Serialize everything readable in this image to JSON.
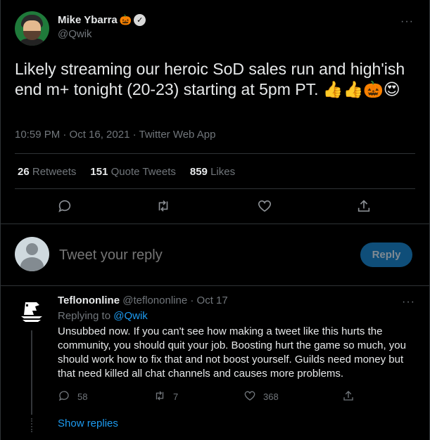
{
  "tweet": {
    "author": {
      "display_name": "Mike Ybarra",
      "name_emoji": "🎃",
      "handle": "@Qwik",
      "verified_icon": "verified-check-icon"
    },
    "more_icon": "···",
    "text": "Likely streaming our heroic SoD sales run and high'ish end m+ tonight (20-23) starting at 5pm PT. 👍👍🎃😍",
    "meta": "10:59 PM · Oct 16, 2021 · Twitter Web App",
    "stats": {
      "retweets_count": "26",
      "retweets_label": "Retweets",
      "quotes_count": "151",
      "quotes_label": "Quote Tweets",
      "likes_count": "859",
      "likes_label": "Likes"
    },
    "actions": [
      "reply",
      "retweet",
      "like",
      "share"
    ]
  },
  "reply_composer": {
    "placeholder": "Tweet your reply",
    "button_label": "Reply"
  },
  "reply": {
    "display_name": "Teflononline",
    "handle": "@teflononline",
    "date": "· Oct 17",
    "more_icon": "···",
    "replying_to_label": "Replying to",
    "replying_to_handle": "@Qwik",
    "text": "Unsubbed now. If you can't see how making a tweet like this hurts the community, you should quit your job. Boosting hurt the game so much, you should work how to fix that and not boost yourself. Guilds need money but that need killed all chat channels and causes more problems.",
    "reply_count": "58",
    "retweet_count": "7",
    "like_count": "368",
    "show_replies": "Show replies"
  },
  "colors": {
    "background": "#000000",
    "accent": "#1d9bf0",
    "muted": "#71767b",
    "reply_button": "#0f4e79"
  }
}
